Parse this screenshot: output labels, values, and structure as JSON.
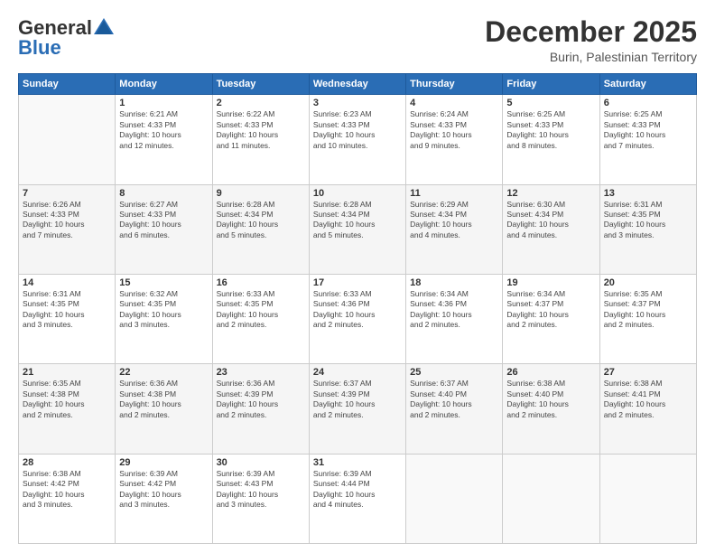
{
  "header": {
    "logo_line1": "General",
    "logo_line2": "Blue",
    "month": "December 2025",
    "location": "Burin, Palestinian Territory"
  },
  "days_of_week": [
    "Sunday",
    "Monday",
    "Tuesday",
    "Wednesday",
    "Thursday",
    "Friday",
    "Saturday"
  ],
  "weeks": [
    [
      {
        "day": null,
        "info": null
      },
      {
        "day": "1",
        "info": "Sunrise: 6:21 AM\nSunset: 4:33 PM\nDaylight: 10 hours\nand 12 minutes."
      },
      {
        "day": "2",
        "info": "Sunrise: 6:22 AM\nSunset: 4:33 PM\nDaylight: 10 hours\nand 11 minutes."
      },
      {
        "day": "3",
        "info": "Sunrise: 6:23 AM\nSunset: 4:33 PM\nDaylight: 10 hours\nand 10 minutes."
      },
      {
        "day": "4",
        "info": "Sunrise: 6:24 AM\nSunset: 4:33 PM\nDaylight: 10 hours\nand 9 minutes."
      },
      {
        "day": "5",
        "info": "Sunrise: 6:25 AM\nSunset: 4:33 PM\nDaylight: 10 hours\nand 8 minutes."
      },
      {
        "day": "6",
        "info": "Sunrise: 6:25 AM\nSunset: 4:33 PM\nDaylight: 10 hours\nand 7 minutes."
      }
    ],
    [
      {
        "day": "7",
        "info": "Sunrise: 6:26 AM\nSunset: 4:33 PM\nDaylight: 10 hours\nand 7 minutes."
      },
      {
        "day": "8",
        "info": "Sunrise: 6:27 AM\nSunset: 4:33 PM\nDaylight: 10 hours\nand 6 minutes."
      },
      {
        "day": "9",
        "info": "Sunrise: 6:28 AM\nSunset: 4:34 PM\nDaylight: 10 hours\nand 5 minutes."
      },
      {
        "day": "10",
        "info": "Sunrise: 6:28 AM\nSunset: 4:34 PM\nDaylight: 10 hours\nand 5 minutes."
      },
      {
        "day": "11",
        "info": "Sunrise: 6:29 AM\nSunset: 4:34 PM\nDaylight: 10 hours\nand 4 minutes."
      },
      {
        "day": "12",
        "info": "Sunrise: 6:30 AM\nSunset: 4:34 PM\nDaylight: 10 hours\nand 4 minutes."
      },
      {
        "day": "13",
        "info": "Sunrise: 6:31 AM\nSunset: 4:35 PM\nDaylight: 10 hours\nand 3 minutes."
      }
    ],
    [
      {
        "day": "14",
        "info": "Sunrise: 6:31 AM\nSunset: 4:35 PM\nDaylight: 10 hours\nand 3 minutes."
      },
      {
        "day": "15",
        "info": "Sunrise: 6:32 AM\nSunset: 4:35 PM\nDaylight: 10 hours\nand 3 minutes."
      },
      {
        "day": "16",
        "info": "Sunrise: 6:33 AM\nSunset: 4:35 PM\nDaylight: 10 hours\nand 2 minutes."
      },
      {
        "day": "17",
        "info": "Sunrise: 6:33 AM\nSunset: 4:36 PM\nDaylight: 10 hours\nand 2 minutes."
      },
      {
        "day": "18",
        "info": "Sunrise: 6:34 AM\nSunset: 4:36 PM\nDaylight: 10 hours\nand 2 minutes."
      },
      {
        "day": "19",
        "info": "Sunrise: 6:34 AM\nSunset: 4:37 PM\nDaylight: 10 hours\nand 2 minutes."
      },
      {
        "day": "20",
        "info": "Sunrise: 6:35 AM\nSunset: 4:37 PM\nDaylight: 10 hours\nand 2 minutes."
      }
    ],
    [
      {
        "day": "21",
        "info": "Sunrise: 6:35 AM\nSunset: 4:38 PM\nDaylight: 10 hours\nand 2 minutes."
      },
      {
        "day": "22",
        "info": "Sunrise: 6:36 AM\nSunset: 4:38 PM\nDaylight: 10 hours\nand 2 minutes."
      },
      {
        "day": "23",
        "info": "Sunrise: 6:36 AM\nSunset: 4:39 PM\nDaylight: 10 hours\nand 2 minutes."
      },
      {
        "day": "24",
        "info": "Sunrise: 6:37 AM\nSunset: 4:39 PM\nDaylight: 10 hours\nand 2 minutes."
      },
      {
        "day": "25",
        "info": "Sunrise: 6:37 AM\nSunset: 4:40 PM\nDaylight: 10 hours\nand 2 minutes."
      },
      {
        "day": "26",
        "info": "Sunrise: 6:38 AM\nSunset: 4:40 PM\nDaylight: 10 hours\nand 2 minutes."
      },
      {
        "day": "27",
        "info": "Sunrise: 6:38 AM\nSunset: 4:41 PM\nDaylight: 10 hours\nand 2 minutes."
      }
    ],
    [
      {
        "day": "28",
        "info": "Sunrise: 6:38 AM\nSunset: 4:42 PM\nDaylight: 10 hours\nand 3 minutes."
      },
      {
        "day": "29",
        "info": "Sunrise: 6:39 AM\nSunset: 4:42 PM\nDaylight: 10 hours\nand 3 minutes."
      },
      {
        "day": "30",
        "info": "Sunrise: 6:39 AM\nSunset: 4:43 PM\nDaylight: 10 hours\nand 3 minutes."
      },
      {
        "day": "31",
        "info": "Sunrise: 6:39 AM\nSunset: 4:44 PM\nDaylight: 10 hours\nand 4 minutes."
      },
      {
        "day": null,
        "info": null
      },
      {
        "day": null,
        "info": null
      },
      {
        "day": null,
        "info": null
      }
    ]
  ]
}
